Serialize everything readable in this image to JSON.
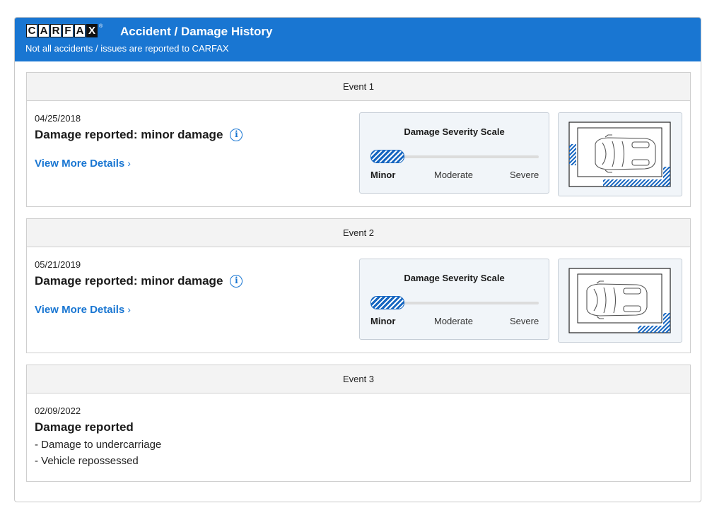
{
  "header": {
    "logo_letters": [
      "C",
      "A",
      "R",
      "F",
      "A",
      "X"
    ],
    "logo_reg": "®",
    "title": "Accident / Damage History",
    "subtitle": "Not all accidents / issues are reported to CARFAX"
  },
  "events": [
    {
      "label": "Event 1",
      "date": "04/25/2018",
      "headline": "Damage reported: minor damage",
      "link": "View More Details",
      "link_icon": "chevron-right-icon",
      "severity": {
        "title": "Damage Severity Scale",
        "labels": [
          "Minor",
          "Moderate",
          "Severe"
        ],
        "level": "Minor"
      },
      "damage_areas": [
        "left-front",
        "rear",
        "right-rear"
      ]
    },
    {
      "label": "Event 2",
      "date": "05/21/2019",
      "headline": "Damage reported: minor damage",
      "link": "View More Details",
      "link_icon": "chevron-right-icon",
      "severity": {
        "title": "Damage Severity Scale",
        "labels": [
          "Minor",
          "Moderate",
          "Severe"
        ],
        "level": "Minor"
      },
      "damage_areas": [
        "right-rear"
      ]
    },
    {
      "label": "Event 3",
      "date": "02/09/2022",
      "headline": "Damage reported",
      "items": [
        "- Damage to undercarriage",
        "- Vehicle repossessed"
      ]
    }
  ],
  "colors": {
    "header_bg": "#1976d2",
    "link": "#1976d2",
    "damage_hatch": "#1565c0"
  }
}
